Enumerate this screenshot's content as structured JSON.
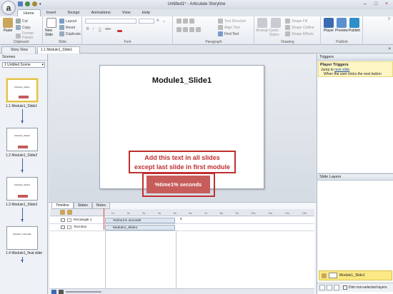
{
  "app": {
    "title": "Untitled1* - Articulate Storyline",
    "logo_letter": "a",
    "window_buttons": [
      "–",
      "□",
      "×"
    ]
  },
  "ribbon_tabs": [
    "Home",
    "Insert",
    "Design",
    "Animations",
    "View",
    "Help"
  ],
  "ribbon": {
    "clipboard": {
      "label": "Clipboard",
      "paste": "Paste",
      "cut": "Cut",
      "copy": "Copy",
      "format_painter": "Format Painter"
    },
    "slide": {
      "label": "Slide",
      "new_slide": "New Slide",
      "layout": "Layout",
      "reset": "Reset",
      "duplicate": "Duplicate"
    },
    "font": {
      "label": "Font",
      "bold": "B",
      "italic": "I",
      "underline": "U",
      "strike": "abc",
      "size_up": "A",
      "size_down": "A"
    },
    "paragraph": {
      "label": "Paragraph",
      "text_direction": "Text Direction",
      "align_text": "Align Text",
      "find_text": "Find Text"
    },
    "drawing": {
      "label": "Drawing",
      "arrange": "Arrange",
      "quick_styles": "Quick Styles",
      "shape_fill": "Shape Fill",
      "shape_outline": "Shape Outline",
      "shape_effects": "Shape Effects"
    },
    "publish": {
      "label": "Publish",
      "player": "Player",
      "preview": "Preview",
      "publish": "Publish"
    }
  },
  "doc_tabs": [
    "Story View",
    "1.1 Module1_Slide1"
  ],
  "scenes": {
    "header": "Scenes",
    "selected_scene": "1 Untitled Scene",
    "slides": [
      {
        "label": "1.1 Module1_Slide1",
        "thumb_title": "Module1_Slide1"
      },
      {
        "label": "1.2 Module1_Slide2",
        "thumb_title": "Module1_Slide2"
      },
      {
        "label": "1.3 Module1_Slide3",
        "thumb_title": "Module1_Slide3"
      },
      {
        "label": "1.4 Module1_final slide",
        "thumb_title": "Module1_final slide"
      }
    ]
  },
  "slide": {
    "title": "Module1_Slide1",
    "callout_line1": "Add this text in all slides",
    "callout_line2": "except last slide in first module",
    "textbox": "%time1% seconds"
  },
  "timeline": {
    "tabs": [
      "Timeline",
      "States",
      "Notes"
    ],
    "ruler": [
      "1s",
      "2s",
      "3s",
      "4s",
      "5s",
      "6s",
      "7s",
      "8s",
      "9s",
      "10s",
      "11s",
      "12s",
      "13s"
    ],
    "end_marker": "5",
    "rows": [
      {
        "name": "Rectangle 1",
        "bar": "%time1% seconds"
      },
      {
        "name": "Text Box",
        "bar": "Module1_Slide1"
      }
    ]
  },
  "triggers": {
    "header": "Triggers",
    "group": "Player Triggers",
    "line1_prefix": "Jump to",
    "line1_link": "next slide",
    "line2": "When the user clicks the next button"
  },
  "layers": {
    "header": "Slide Layers",
    "base_layer": "Module1_Slide1",
    "dim_label": "Dim non-selected layers"
  }
}
